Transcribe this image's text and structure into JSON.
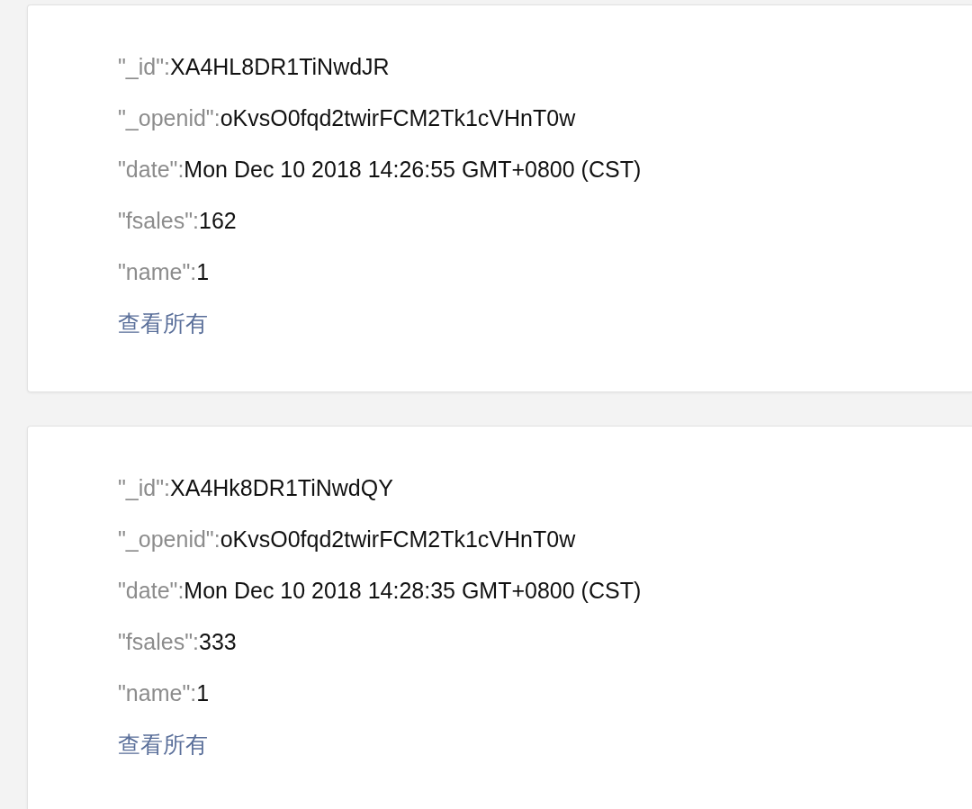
{
  "records": [
    {
      "fields": [
        {
          "key": "\"_id\":",
          "value": "XA4HL8DR1TiNwdJR"
        },
        {
          "key": "\"_openid\":",
          "value": "oKvsO0fqd2twirFCM2Tk1cVHnT0w"
        },
        {
          "key": "\"date\":",
          "value": "Mon Dec 10 2018 14:26:55 GMT+0800 (CST)"
        },
        {
          "key": "\"fsales\":",
          "value": "162"
        },
        {
          "key": "\"name\":",
          "value": "1"
        }
      ],
      "link": "查看所有"
    },
    {
      "fields": [
        {
          "key": "\"_id\":",
          "value": "XA4Hk8DR1TiNwdQY"
        },
        {
          "key": "\"_openid\":",
          "value": "oKvsO0fqd2twirFCM2Tk1cVHnT0w"
        },
        {
          "key": "\"date\":",
          "value": "Mon Dec 10 2018 14:28:35 GMT+0800 (CST)"
        },
        {
          "key": "\"fsales\":",
          "value": "333"
        },
        {
          "key": "\"name\":",
          "value": "1"
        }
      ],
      "link": "查看所有"
    }
  ]
}
